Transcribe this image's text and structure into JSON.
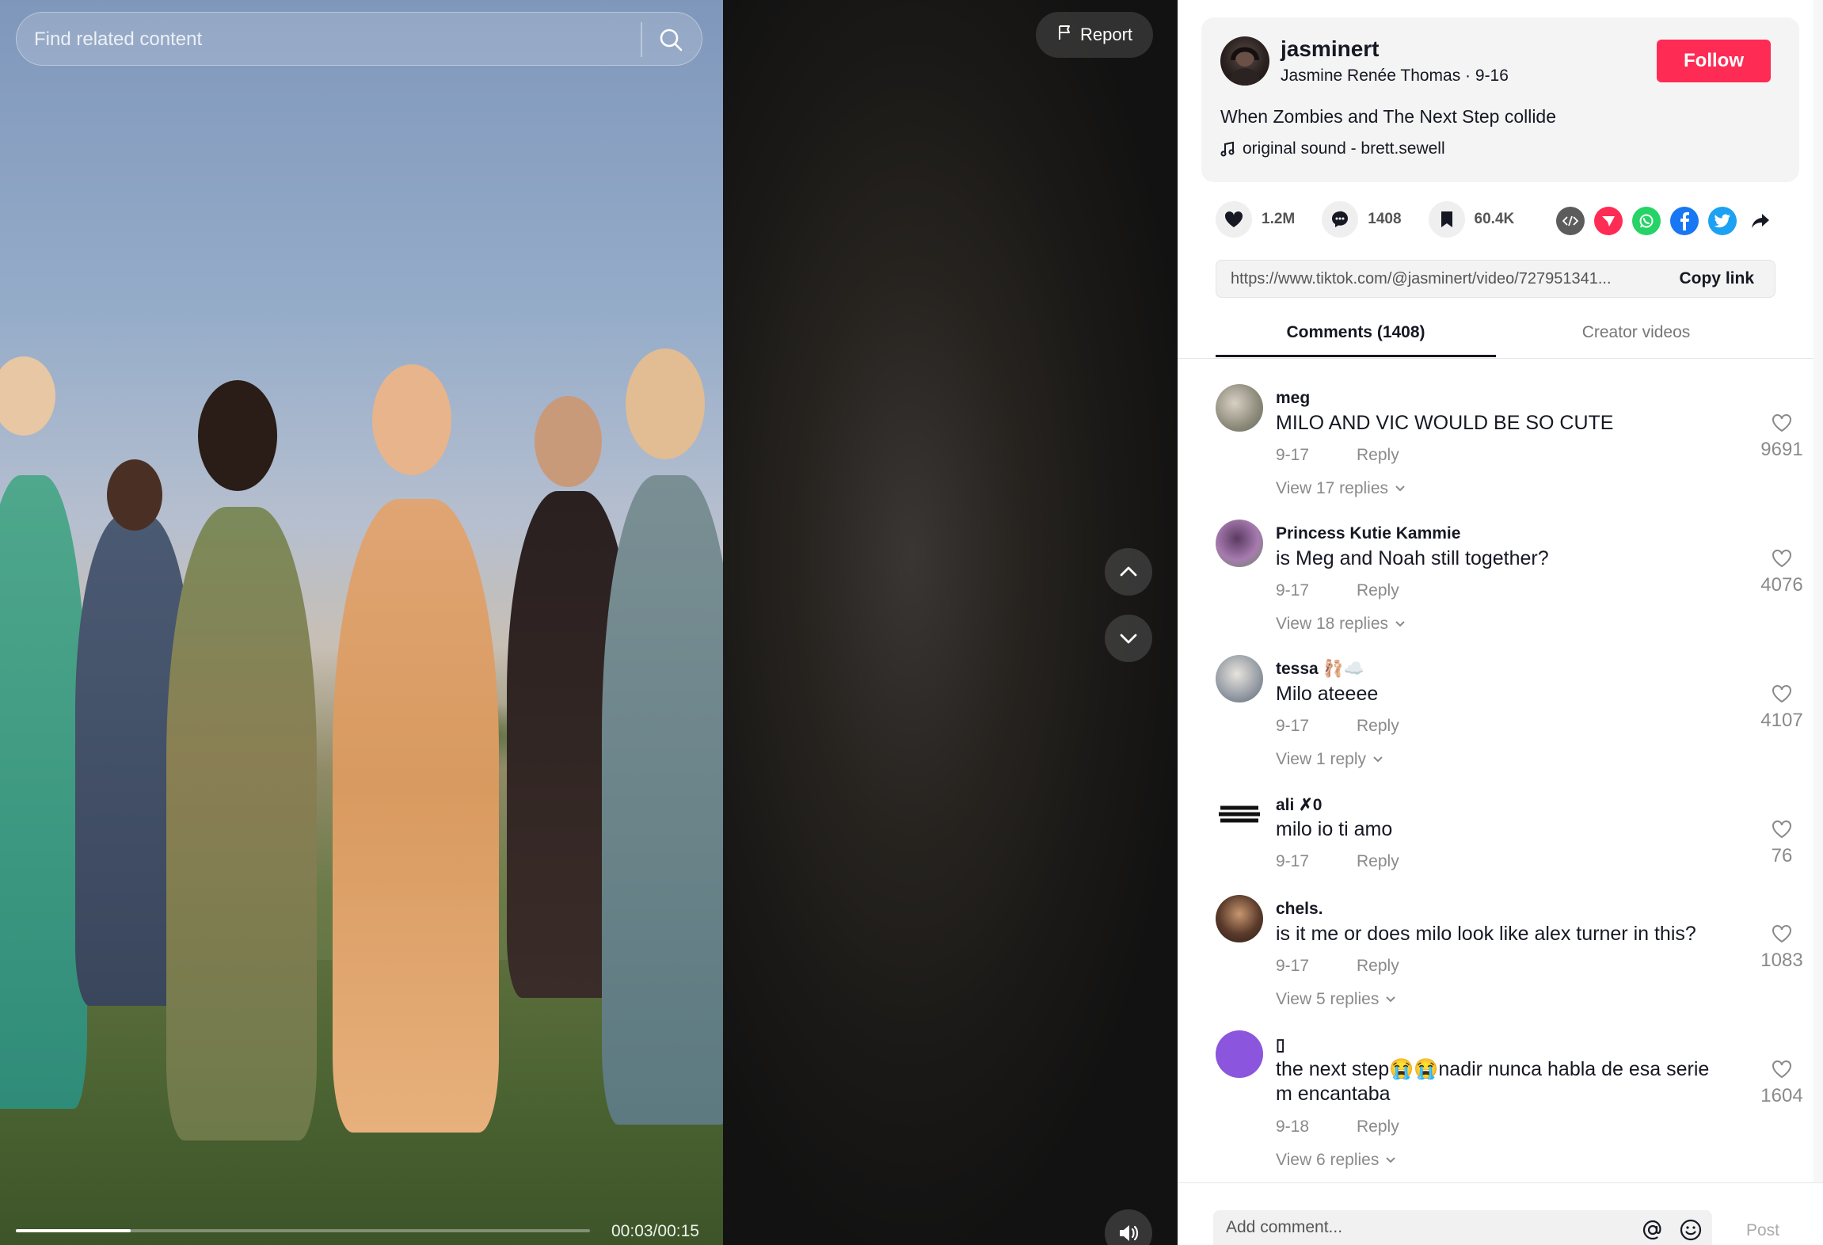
{
  "search": {
    "placeholder": "Find related content"
  },
  "report": {
    "label": "Report"
  },
  "player": {
    "time": "00:03/00:15",
    "progress": 0.2
  },
  "author": {
    "username": "jasminert",
    "subline": "Jasmine Renée Thomas · 9-16",
    "follow_label": "Follow"
  },
  "video": {
    "caption": "When Zombies and The Next Step collide",
    "sound": "original sound - brett.sewell"
  },
  "stats": {
    "likes": "1.2M",
    "comments": "1408",
    "saves": "60.4K"
  },
  "share_icons": [
    "embed-icon",
    "send-to-friends-icon",
    "whatsapp-icon",
    "facebook-icon",
    "twitter-icon",
    "share-arrow-icon"
  ],
  "link": {
    "url": "https://www.tiktok.com/@jasminert/video/727951341...",
    "copy_label": "Copy link"
  },
  "tabs": {
    "comments": "Comments (1408)",
    "creator": "Creator videos"
  },
  "comments": [
    {
      "user": "meg",
      "text": "MILO AND VIC WOULD BE SO CUTE",
      "date": "9-17",
      "reply": "Reply",
      "likes": "9691",
      "views": "View 17 replies"
    },
    {
      "user": "Princess Kutie Kammie",
      "text": "is Meg and Noah still together?",
      "date": "9-17",
      "reply": "Reply",
      "likes": "4076",
      "views": "View 18 replies"
    },
    {
      "user": "tessa 🩰☁️",
      "text": "Milo ateeee",
      "date": "9-17",
      "reply": "Reply",
      "likes": "4107",
      "views": "View 1 reply"
    },
    {
      "user": "ali ✗0",
      "text": "milo io ti amo",
      "date": "9-17",
      "reply": "Reply",
      "likes": "76",
      "views": ""
    },
    {
      "user": "chels.",
      "text": "is it me or does milo look like alex turner in this?",
      "date": "9-17",
      "reply": "Reply",
      "likes": "1083",
      "views": "View 5 replies"
    },
    {
      "user": "▯",
      "text": "the next step😭😭nadir nunca habla de esa serie m encantaba",
      "date": "9-18",
      "reply": "Reply",
      "likes": "1604",
      "views": "View 6 replies"
    }
  ],
  "footer": {
    "placeholder": "Add comment...",
    "post_label": "Post"
  },
  "colors": {
    "follow": "#fe2c55",
    "text": "#161823",
    "muted": "#8a8a8a"
  }
}
